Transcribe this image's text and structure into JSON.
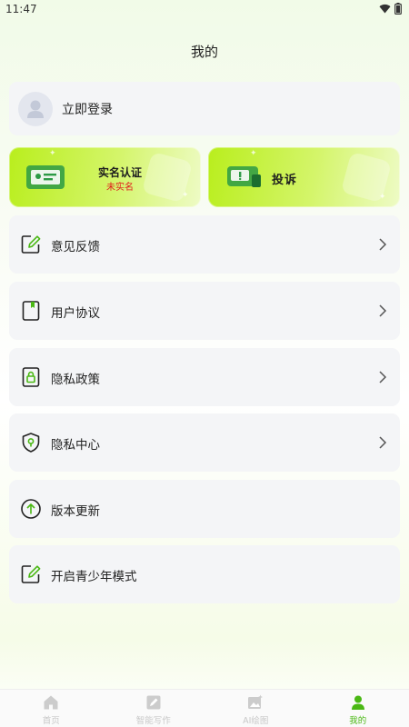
{
  "status_bar": {
    "time": "11:47"
  },
  "page": {
    "title": "我的"
  },
  "login": {
    "label": "立即登录"
  },
  "banners": {
    "verify": {
      "title": "实名认证",
      "status": "未实名"
    },
    "complain": {
      "title": "投诉"
    }
  },
  "menu": [
    {
      "label": "意见反馈",
      "icon": "edit-icon",
      "has_arrow": true
    },
    {
      "label": "用户协议",
      "icon": "bookmark-doc-icon",
      "has_arrow": true
    },
    {
      "label": "隐私政策",
      "icon": "lock-doc-icon",
      "has_arrow": true
    },
    {
      "label": "隐私中心",
      "icon": "shield-icon",
      "has_arrow": true
    },
    {
      "label": "版本更新",
      "icon": "upload-circle-icon",
      "has_arrow": false
    },
    {
      "label": "开启青少年模式",
      "icon": "edit-icon",
      "has_arrow": false
    }
  ],
  "tabs": [
    {
      "label": "首页",
      "icon": "home-icon",
      "active": false
    },
    {
      "label": "智能写作",
      "icon": "write-icon",
      "active": false
    },
    {
      "label": "AI绘图",
      "icon": "image-icon",
      "active": false
    },
    {
      "label": "我的",
      "icon": "user-icon",
      "active": true
    }
  ],
  "colors": {
    "accent": "#4ab814",
    "banner_green": "#b9ee1d",
    "alert_red": "#e11b1b",
    "card_bg": "#f4f5f7"
  }
}
